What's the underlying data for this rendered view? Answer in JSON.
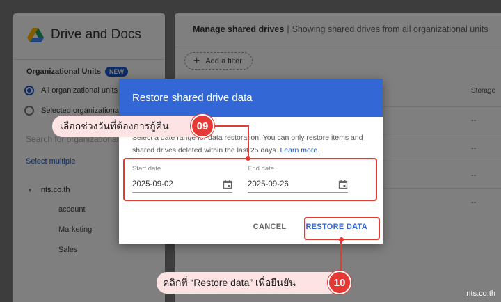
{
  "sidebar": {
    "brand_title": "Drive and Docs",
    "ou_heading": "Organizational Units",
    "new_badge": "NEW",
    "radio_all": "All organizational units",
    "radio_selected": "Selected organizational units",
    "search_placeholder": "Search for organizational units",
    "select_multiple": "Select multiple",
    "tree_root": "nts.co.th",
    "tree_children": [
      "account",
      "Marketing",
      "Sales"
    ]
  },
  "main": {
    "heading_bold": "Manage shared drives",
    "heading_sep": "|",
    "heading_sub": "Showing shared drives from all organizational units",
    "add_filter": "Add a filter",
    "col_storage": "Storage",
    "row_values": [
      "--",
      "--",
      "--",
      "--"
    ]
  },
  "dialog": {
    "title": "Restore shared drive data",
    "desc_text": "Select a date range for data restoration. You can only restore items and shared drives deleted within the last 25 days.",
    "learn_more": "Learn more.",
    "start_label": "Start date",
    "start_value": "2025-09-02",
    "end_label": "End date",
    "end_value": "2025-09-26",
    "cancel_label": "CANCEL",
    "restore_label": "RESTORE DATA"
  },
  "annotations": {
    "step1_text": "เลือกช่วงวันที่ต้องการกู้คืน",
    "step1_number": "09",
    "step2_text": "คลิกที่ “Restore data” เพื่อยืนยัน",
    "step2_number": "10",
    "accent_color": "#e53935"
  },
  "watermark": "nts.co.th"
}
